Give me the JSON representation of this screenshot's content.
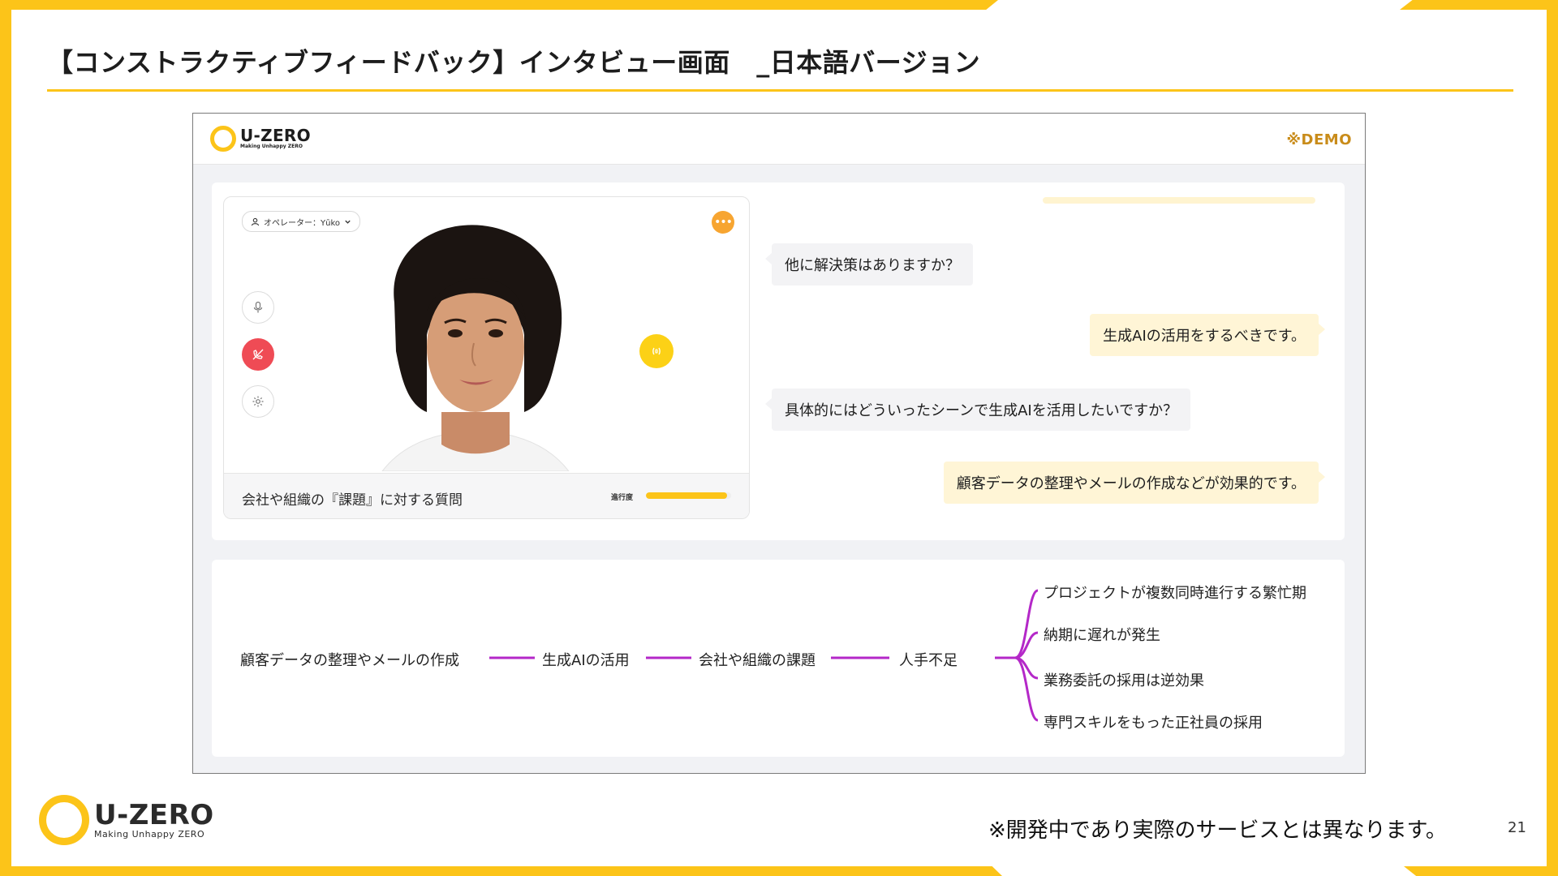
{
  "slide": {
    "title": "【コンストラクティブフィードバック】インタビュー画面　_日本語バージョン",
    "disclaimer": "※開発中であり実際のサービスとは異なります。",
    "page_number": "21"
  },
  "brand": {
    "name": "U-ZERO",
    "tagline": "Making Unhappy ZERO",
    "accent_color": "#fcc419"
  },
  "app": {
    "demo_label": "※DEMO",
    "operator_selector": "オペレーター：Yūko",
    "current_question_label": "会社や組織の『課題』に対する質問",
    "progress_label": "進行度",
    "progress_fraction": 0.95,
    "chat": [
      {
        "role": "interviewer",
        "text": "他に解決策はありますか？"
      },
      {
        "role": "user",
        "text": "生成AIの活用をするべきです。"
      },
      {
        "role": "interviewer",
        "text": "具体的にはどういったシーンで生成AIを活用したいですか？"
      },
      {
        "role": "user",
        "text": "顧客データの整理やメールの作成などが効果的です。"
      }
    ],
    "mindmap": {
      "chain": [
        "顧客データの整理やメールの作成",
        "生成AIの活用",
        "会社や組織の課題",
        "人手不足"
      ],
      "branches": [
        "プロジェクトが複数同時進行する繁忙期",
        "納期に遅れが発生",
        "業務委託の採用は逆効果",
        "専門スキルをもった正社員の採用"
      ],
      "link_color": "#b428c8"
    }
  }
}
